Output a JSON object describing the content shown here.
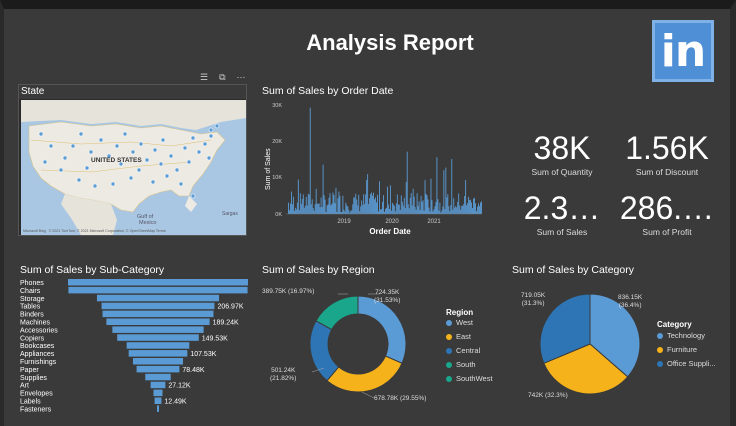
{
  "report": {
    "title": "Analysis Report",
    "logo_text": "in"
  },
  "colors": {
    "background": "#3a3a3a",
    "accent": "#5b9bd5",
    "orange": "#f5b21b",
    "dark_blue": "#2e75b6",
    "teal": "#1aa68b",
    "map_water": "#a9c7e3",
    "map_land": "#e9e6df"
  },
  "map": {
    "title": "State",
    "country_label": "UNITED STATES",
    "gulf_label": "Gulf of\nMexico",
    "mexico_label": "Mexico",
    "sargasso_label": "Sargas",
    "attribution": "© 2021 TomTom, © 2021 Microsoft Corporation, © OpenStreetMap Terms",
    "brand": "Microsoft Bing",
    "toolbar_icons": [
      "filter-icon",
      "focus-mode-icon",
      "more-options-icon"
    ]
  },
  "order_date": {
    "title": "Sum of Sales by Order Date",
    "y_ticks": [
      "30K",
      "20K",
      "10K",
      "0K"
    ],
    "x_ticks": [
      "2019",
      "2020",
      "2021"
    ],
    "ylabel": "Sum of Sales",
    "xlabel": "Order Date"
  },
  "kpis": [
    {
      "value": "38K",
      "label": "Sum of Quantity"
    },
    {
      "value": "1.56K",
      "label": "Sum of Discount"
    },
    {
      "value": "2.3…",
      "label": "Sum of Sales"
    },
    {
      "value": "286.…",
      "label": "Sum of Profit"
    }
  ],
  "subcategory": {
    "title": "Sum of Sales by Sub-Category",
    "categories": [
      "Phones",
      "Chairs",
      "Storage",
      "Tables",
      "Binders",
      "Machines",
      "Accessories",
      "Copiers",
      "Bookcases",
      "Appliances",
      "Furnishings",
      "Paper",
      "Supplies",
      "Art",
      "Envelopes",
      "Labels",
      "Fasteners"
    ],
    "values": [
      330.01,
      328.45,
      223.84,
      206.97,
      203.41,
      189.24,
      167.38,
      149.53,
      114.88,
      107.53,
      91.71,
      78.48,
      46.67,
      27.12,
      16.48,
      12.49,
      3.02
    ],
    "shown_labels": [
      "",
      "",
      "",
      "206.97K",
      "",
      "189.24K",
      "",
      "149.53K",
      "",
      "107.53K",
      "",
      "78.48K",
      "",
      "27.12K",
      "",
      "12.49K",
      ""
    ]
  },
  "region": {
    "title": "Sum of Sales by Region",
    "legend_title": "Region",
    "series": [
      {
        "name": "West",
        "value": 724.35,
        "label": "724.35K\n(31.53%)",
        "color": "#5b9bd5"
      },
      {
        "name": "East",
        "value": 678.78,
        "label": "678.78K (29.55%)",
        "color": "#f5b21b"
      },
      {
        "name": "Central",
        "value": 501.24,
        "label": "501.24K\n(21.82%)",
        "color": "#2e75b6"
      },
      {
        "name": "South",
        "value": 389.75,
        "label": "389.75K (16.97%)",
        "color": "#1aa68b"
      },
      {
        "name": "SouthWest",
        "value": 0,
        "label": "",
        "color": "#1aa68b"
      }
    ]
  },
  "category": {
    "title": "Sum of Sales by Category",
    "legend_title": "Category",
    "series": [
      {
        "name": "Technology",
        "value": 836.15,
        "label": "836.15K\n(36.4%)",
        "color": "#5b9bd5"
      },
      {
        "name": "Furniture",
        "value": 742.0,
        "label": "742K (32.3%)",
        "color": "#f5b21b"
      },
      {
        "name": "Office Suppli...",
        "value": 719.05,
        "label": "719.05K\n(31.3%)",
        "color": "#2e75b6"
      }
    ]
  }
}
